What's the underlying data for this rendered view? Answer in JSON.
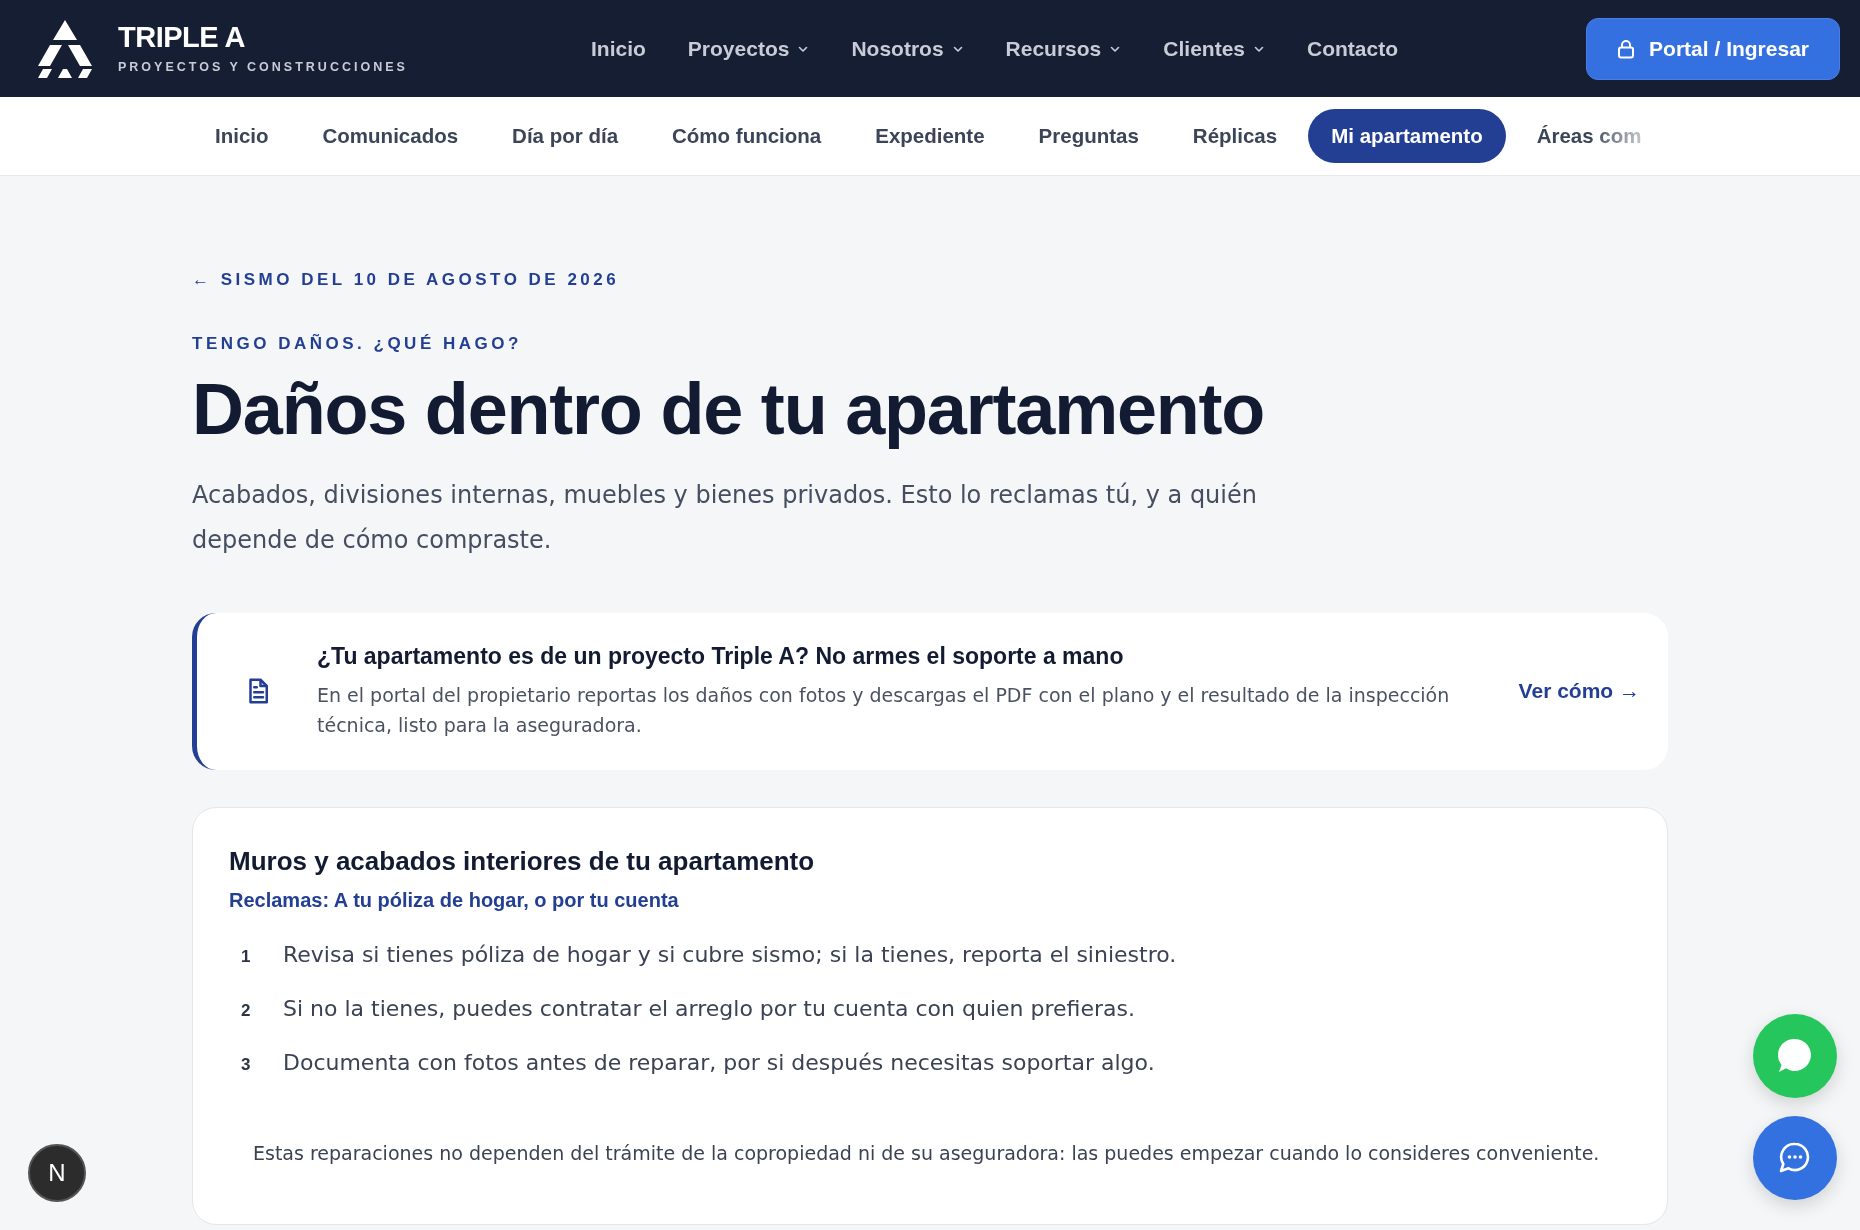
{
  "header": {
    "brand": {
      "name": "TRIPLE A",
      "tagline": "PROYECTOS Y CONSTRUCCIONES"
    },
    "nav": [
      {
        "label": "Inicio",
        "has_menu": false
      },
      {
        "label": "Proyectos",
        "has_menu": true
      },
      {
        "label": "Nosotros",
        "has_menu": true
      },
      {
        "label": "Recursos",
        "has_menu": true
      },
      {
        "label": "Clientes",
        "has_menu": true
      },
      {
        "label": "Contacto",
        "has_menu": false
      }
    ],
    "portal_button": "Portal / Ingresar"
  },
  "tabs": [
    {
      "label": "Inicio",
      "selected": false
    },
    {
      "label": "Comunicados",
      "selected": false
    },
    {
      "label": "Día por día",
      "selected": false
    },
    {
      "label": "Cómo funciona",
      "selected": false
    },
    {
      "label": "Expediente",
      "selected": false
    },
    {
      "label": "Preguntas",
      "selected": false
    },
    {
      "label": "Réplicas",
      "selected": false
    },
    {
      "label": "Mi apartamento",
      "selected": true
    },
    {
      "label": "Áreas com",
      "selected": false
    }
  ],
  "back_link": "← SISMO DEL 10 DE AGOSTO DE 2026",
  "eyebrow": "TENGO DAÑOS. ¿QUÉ HAGO?",
  "title": "Daños dentro de tu apartamento",
  "intro": "Acabados, divisiones internas, muebles y bienes privados. Esto lo reclamas tú, y a quién depende de cómo compraste.",
  "callout": {
    "title": "¿Tu apartamento es de un proyecto Triple A? No armes el soporte a mano",
    "text": "En el portal del propietario reportas los daños con fotos y descargas el PDF con el plano y el resultado de la inspección técnica, listo para la aseguradora.",
    "link": "Ver cómo →"
  },
  "section": {
    "title": "Muros y acabados interiores de tu apartamento",
    "claim": "Reclamas: A tu póliza de hogar, o por tu cuenta",
    "steps": [
      {
        "number": "1",
        "text": "Revisa si tienes póliza de hogar y si cubre sismo; si la tienes, reporta el siniestro."
      },
      {
        "number": "2",
        "text": "Si no la tienes, puedes contratar el arreglo por tu cuenta con quien prefieras."
      },
      {
        "number": "3",
        "text": "Documenta con fotos antes de reparar, por si después necesitas soportar algo."
      }
    ],
    "note": "Estas reparaciones no dependen del trámite de la copropiedad ni de su aseguradora: las puedes empezar cuando lo consideres conveniente."
  },
  "dev_badge": "N"
}
